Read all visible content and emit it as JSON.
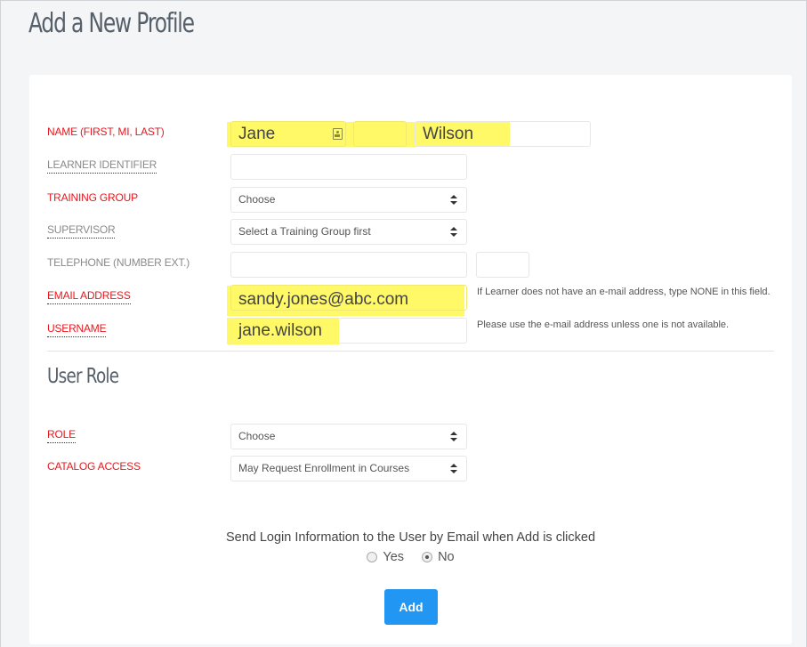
{
  "page": {
    "title": "Add a New Profile"
  },
  "form": {
    "name": {
      "label": "NAME (FIRST, MI, LAST)",
      "first": "Jane",
      "mi": "",
      "last": "Wilson"
    },
    "learner_identifier": {
      "label": "LEARNER IDENTIFIER",
      "value": ""
    },
    "training_group": {
      "label": "TRAINING GROUP",
      "selected": "Choose"
    },
    "supervisor": {
      "label": "SUPERVISOR",
      "selected": "Select a Training Group first"
    },
    "telephone": {
      "label": "TELEPHONE (NUMBER EXT.)",
      "number": "",
      "ext": ""
    },
    "email": {
      "label": "EMAIL ADDRESS",
      "value": "sandy.jones@abc.com",
      "help": "If Learner does not have an e-mail address, type NONE in this field."
    },
    "username": {
      "label": "USERNAME",
      "value": "jane.wilson",
      "help": "Please use the e-mail address unless one is not available."
    }
  },
  "user_role": {
    "title": "User Role",
    "role": {
      "label": "ROLE",
      "selected": "Choose"
    },
    "catalog_access": {
      "label": "CATALOG ACCESS",
      "selected": "May Request Enrollment in Courses"
    }
  },
  "send_login": {
    "text": "Send Login Information to the User by Email when Add is clicked",
    "options": [
      {
        "label": "Yes",
        "checked": false
      },
      {
        "label": "No",
        "checked": true
      }
    ]
  },
  "actions": {
    "add_label": "Add",
    "add_color": "#2196f3"
  },
  "colors": {
    "required_label": "#e8181e",
    "autofill_highlight": "#fff967"
  }
}
